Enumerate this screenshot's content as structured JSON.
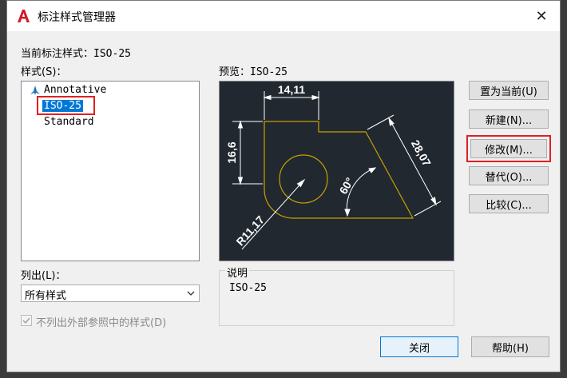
{
  "window": {
    "title": "标注样式管理器",
    "close": "✕"
  },
  "current_style": {
    "label": "当前标注样式：",
    "value": "ISO-25"
  },
  "styles": {
    "label": "样式(S)：",
    "items": [
      "Annotative",
      "ISO-25",
      "Standard"
    ],
    "selected": "ISO-25"
  },
  "preview": {
    "label": "预览：",
    "value": "ISO-25",
    "dims": {
      "width": "14,11",
      "height": "16,6",
      "diagonal": "28,07",
      "angle": "60°",
      "radius": "R11,17"
    }
  },
  "list_filter": {
    "label": "列出(L)：",
    "value": "所有样式"
  },
  "exclude_xref": {
    "label": "不列出外部参照中的样式(D)",
    "checked": true
  },
  "description": {
    "label": "说明",
    "value": "ISO-25"
  },
  "buttons": {
    "set_current": "置为当前(U)",
    "new": "新建(N)...",
    "modify": "修改(M)...",
    "override": "替代(O)...",
    "compare": "比较(C)...",
    "close": "关闭",
    "help": "帮助(H)"
  },
  "colors": {
    "accent": "#0078d7",
    "highlight": "#e02020",
    "preview_bg": "#212830",
    "geometry": "#c8a000"
  }
}
